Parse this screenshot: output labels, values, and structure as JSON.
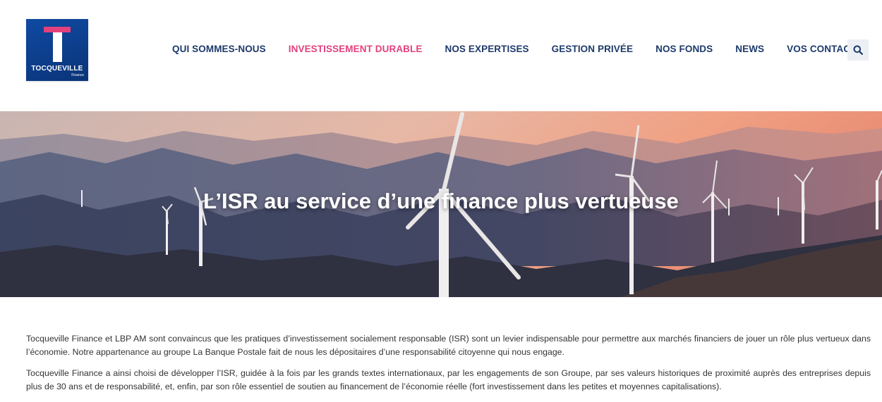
{
  "logo": {
    "name": "TOCQUEVILLE",
    "sub": "Finance"
  },
  "nav": {
    "items": [
      {
        "label": "QUI SOMMES-NOUS"
      },
      {
        "label": "INVESTISSEMENT DURABLE"
      },
      {
        "label": "NOS EXPERTISES"
      },
      {
        "label": "GESTION PRIVÉE"
      },
      {
        "label": "NOS FONDS"
      },
      {
        "label": "NEWS"
      },
      {
        "label": "VOS CONTACTS"
      }
    ],
    "active_index": 1,
    "active_color": "#e3417d",
    "search_icon": "search-icon"
  },
  "hero": {
    "title": "L’ISR au service d’une finance plus vertueuse"
  },
  "content": {
    "paragraphs": [
      "Tocqueville Finance et LBP AM sont convaincus que les pratiques d’investissement socialement responsable (ISR) sont un levier indispensable pour permettre aux marchés financiers de jouer un rôle plus vertueux dans l’économie. Notre appartenance au groupe La Banque Postale fait de nous les dépositaires d’une responsabilité citoyenne qui nous engage.",
      "Tocqueville Finance a ainsi choisi de développer l’ISR, guidée à la fois par les grands textes internationaux, par les engagements de son Groupe, par ses valeurs historiques de proximité auprès des entreprises depuis plus de 30 ans et de responsabilité, et, enfin, par son rôle essentiel de soutien au financement de l’économie réelle (fort investissement dans les petites et moyennes capitalisations)."
    ]
  },
  "colors": {
    "brand_blue": "#0a3477",
    "nav_text": "#1e3a6b",
    "accent_pink": "#e3417d"
  }
}
